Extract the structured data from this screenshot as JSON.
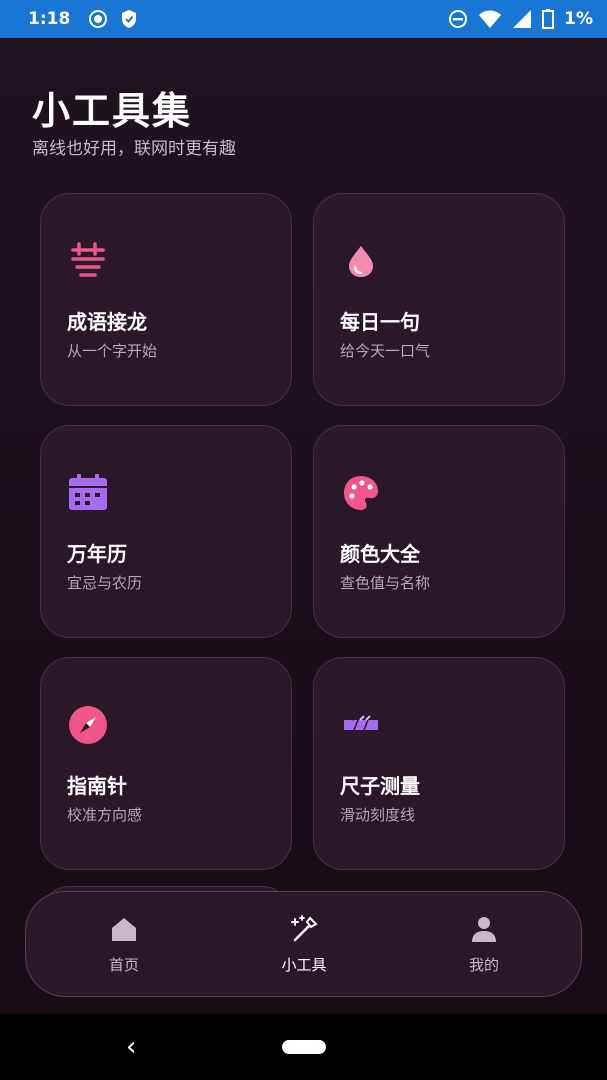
{
  "status_bar": {
    "time": "1:18",
    "battery": "1%",
    "icons": [
      "record-icon",
      "shield-icon",
      "dnd-icon",
      "wifi-icon",
      "signal-icon",
      "battery-icon"
    ]
  },
  "header": {
    "title": "小工具集",
    "subtitle": "离线也好用，联网时更有趣"
  },
  "tools": [
    {
      "name": "成语接龙",
      "desc": "从一个字开始",
      "icon": "text-lines-icon"
    },
    {
      "name": "每日一句",
      "desc": "给今天一口气",
      "icon": "droplet-icon"
    },
    {
      "name": "万年历",
      "desc": "宜忌与农历",
      "icon": "calendar-icon"
    },
    {
      "name": "颜色大全",
      "desc": "查色值与名称",
      "icon": "palette-icon"
    },
    {
      "name": "指南针",
      "desc": "校准方向感",
      "icon": "compass-icon"
    },
    {
      "name": "尺子测量",
      "desc": "滑动刻度线",
      "icon": "ruler-icon"
    }
  ],
  "bottom_nav": {
    "items": [
      {
        "label": "首页",
        "icon": "home-icon"
      },
      {
        "label": "小工具",
        "icon": "magic-wand-icon",
        "active": true
      },
      {
        "label": "我的",
        "icon": "person-icon"
      }
    ]
  },
  "colors": {
    "accent_pink": "#f0568a",
    "accent_purple": "#a86bf0",
    "background": "#1a0f18",
    "card": "#2a1728",
    "status_bar": "#1976d2"
  }
}
